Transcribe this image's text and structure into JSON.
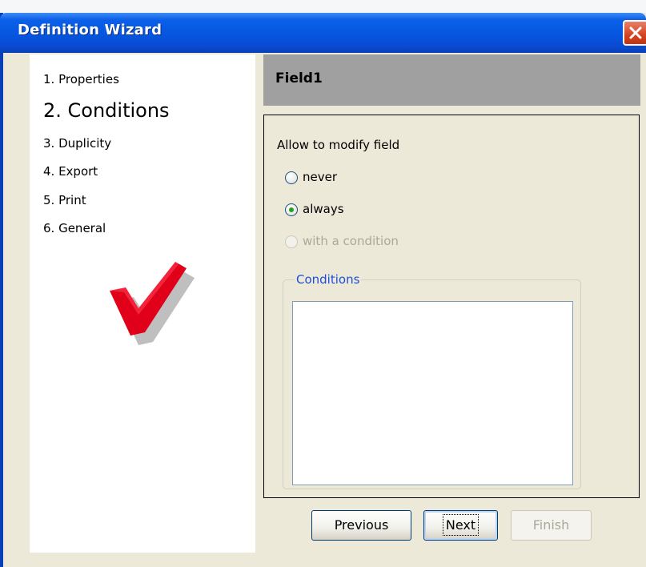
{
  "window": {
    "title": "Definition Wizard"
  },
  "steps": [
    {
      "label": "1. Properties"
    },
    {
      "label": "2. Conditions",
      "current": true
    },
    {
      "label": "3. Duplicity"
    },
    {
      "label": "4. Export"
    },
    {
      "label": "5. Print"
    },
    {
      "label": "6. General"
    }
  ],
  "field": {
    "name": "Field1"
  },
  "modify": {
    "label": "Allow to modify field",
    "options": [
      {
        "label": "never",
        "selected": false,
        "enabled": true
      },
      {
        "label": "always",
        "selected": true,
        "enabled": true
      },
      {
        "label": "with a condition",
        "selected": false,
        "enabled": false
      }
    ]
  },
  "conditions": {
    "legend": "Conditions"
  },
  "buttons": {
    "previous": "Previous",
    "next": "Next",
    "finish": "Finish"
  },
  "colors": {
    "titlebar": "#0556e0",
    "accent_check": "#e0001a",
    "legend": "#1e4ed8"
  },
  "icons": {
    "close": "close-icon",
    "check": "checkmark-icon"
  }
}
